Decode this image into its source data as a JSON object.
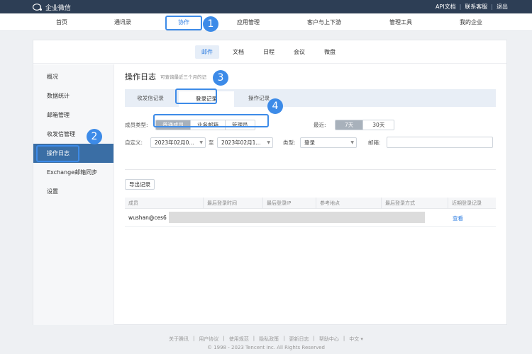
{
  "topbar": {
    "brand": "企业微信",
    "links": [
      "API文档",
      "联系客服",
      "退出"
    ]
  },
  "mainnav": {
    "items": [
      "首页",
      "通讯录",
      "协作",
      "应用管理",
      "客户与上下游",
      "管理工具",
      "我的企业"
    ],
    "active": "协作"
  },
  "subnav": {
    "items": [
      "邮件",
      "文档",
      "日程",
      "会议",
      "微盘"
    ],
    "active": "邮件"
  },
  "sidebar": {
    "items": [
      "概况",
      "数据统计",
      "邮箱管理",
      "收发信管理",
      "操作日志",
      "Exchange邮箱同步",
      "设置"
    ],
    "active": "操作日志"
  },
  "page": {
    "title": "操作日志",
    "subtitle": "可查询最近三个月的记"
  },
  "tabs": [
    "收发信记录",
    "登录记录",
    "操作记录"
  ],
  "filters": {
    "member_type_label": "成员类型:",
    "member_types": [
      "普通成员",
      "业务邮箱",
      "管理员"
    ],
    "recent_label": "最近:",
    "recent_options": [
      "7天",
      "30天"
    ],
    "custom_label": "自定义:",
    "date_from": "2023年02月0...",
    "to_label": "至",
    "date_to": "2023年02月1...",
    "type_label": "类型:",
    "type_value": "登录",
    "mailbox_label": "邮箱:",
    "mailbox_value": ""
  },
  "export_button": "导出记录",
  "table": {
    "headers": [
      "成员",
      "最后登录时间",
      "最后登录IP",
      "参考地点",
      "最后登录方式",
      "近期登录记录"
    ],
    "rows": [
      {
        "member": "wushan@ces6",
        "action": "查看"
      }
    ]
  },
  "markers": [
    "1",
    "2",
    "3",
    "4"
  ],
  "footer": {
    "links": [
      "关于腾讯",
      "|",
      "用户协议",
      "|",
      "使用规范",
      "|",
      "隐私政策",
      "|",
      "更新日志",
      "|",
      "帮助中心",
      "|",
      "中文 ▾"
    ],
    "copyright": "© 1998 - 2023 Tencent Inc. All Rights Reserved"
  },
  "colors": {
    "topbar": "#2d3e55",
    "accent": "#2e7de1",
    "sidebar_active": "#3a6ea5",
    "marker": "#3d8be8"
  }
}
